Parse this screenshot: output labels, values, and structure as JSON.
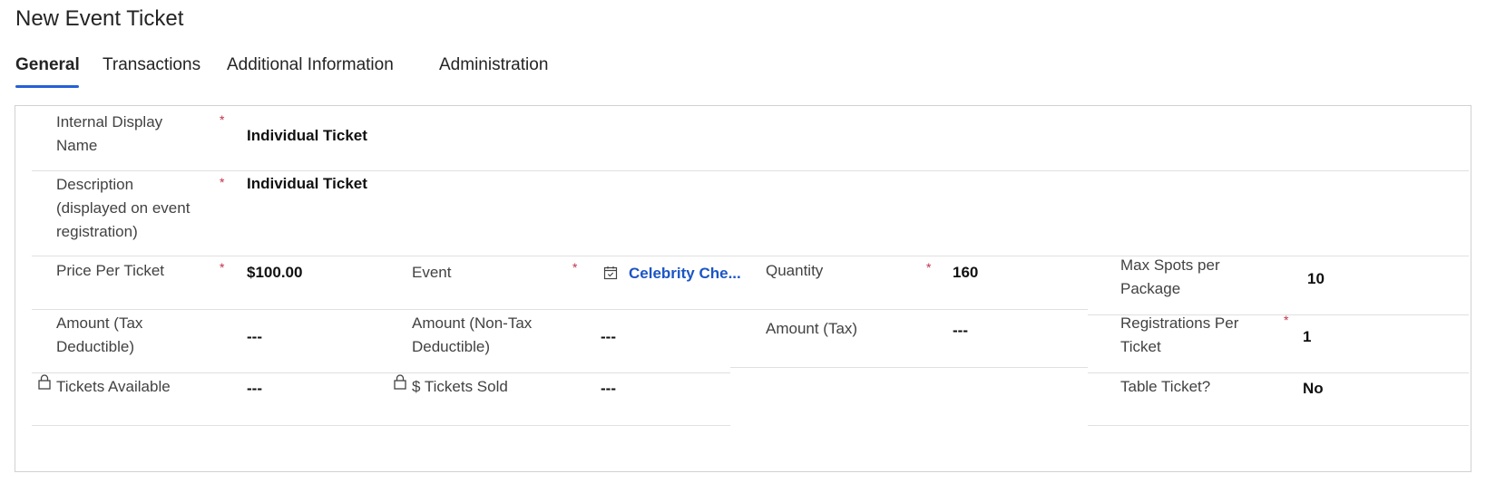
{
  "page": {
    "title": "New Event Ticket"
  },
  "tabs": [
    {
      "label": "General",
      "active": true
    },
    {
      "label": "Transactions",
      "active": false
    },
    {
      "label": "Additional Information",
      "active": false
    },
    {
      "label": "Administration",
      "active": false
    }
  ],
  "required_marker": "*",
  "fields": {
    "internal_display_name": {
      "label_line1": "Internal Display",
      "label_line2": "Name",
      "value": "Individual Ticket"
    },
    "description": {
      "label_line1": "Description",
      "label_line2": "(displayed on event",
      "label_line3": "registration)",
      "value": "Individual Ticket"
    },
    "price_per_ticket": {
      "label": "Price Per Ticket",
      "value": "$100.00"
    },
    "event": {
      "label": "Event",
      "value": "Celebrity Che...",
      "icon": "calendar-icon"
    },
    "quantity": {
      "label": "Quantity",
      "value": "160"
    },
    "max_spots_per_package": {
      "label_line1": "Max Spots per",
      "label_line2": "Package",
      "value": "10"
    },
    "amount_tax_deductible": {
      "label_line1": "Amount (Tax",
      "label_line2": "Deductible)",
      "value": "---"
    },
    "amount_non_tax_deductible": {
      "label_line1": "Amount (Non-Tax",
      "label_line2": "Deductible)",
      "value": "---"
    },
    "amount_tax": {
      "label": "Amount (Tax)",
      "value": "---"
    },
    "registrations_per_ticket": {
      "label_line1": "Registrations Per",
      "label_line2": "Ticket",
      "value": "1"
    },
    "tickets_available": {
      "label": "Tickets Available",
      "value": "---",
      "icon": "lock-icon"
    },
    "tickets_sold": {
      "label": "$ Tickets Sold",
      "value": "---",
      "icon": "lock-icon"
    },
    "table_ticket": {
      "label": "Table Ticket?",
      "value": "No"
    }
  },
  "colors": {
    "accent": "#2560d6",
    "required": "#c4314b",
    "link": "#1c55c4"
  }
}
